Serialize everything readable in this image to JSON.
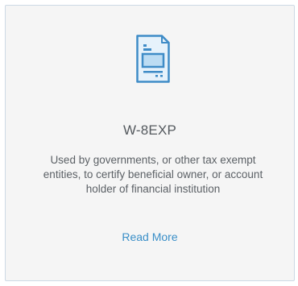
{
  "card": {
    "icon": "document-form-icon",
    "title": "W-8EXP",
    "description": "Used by governments, or other tax exempt entities, to certify beneficial owner, or account holder of financial institution",
    "read_more_label": "Read More"
  },
  "colors": {
    "accent": "#3a8fc8",
    "card_background": "#f5f5f5",
    "card_border": "#cdd9e5",
    "text": "#5c6166"
  }
}
